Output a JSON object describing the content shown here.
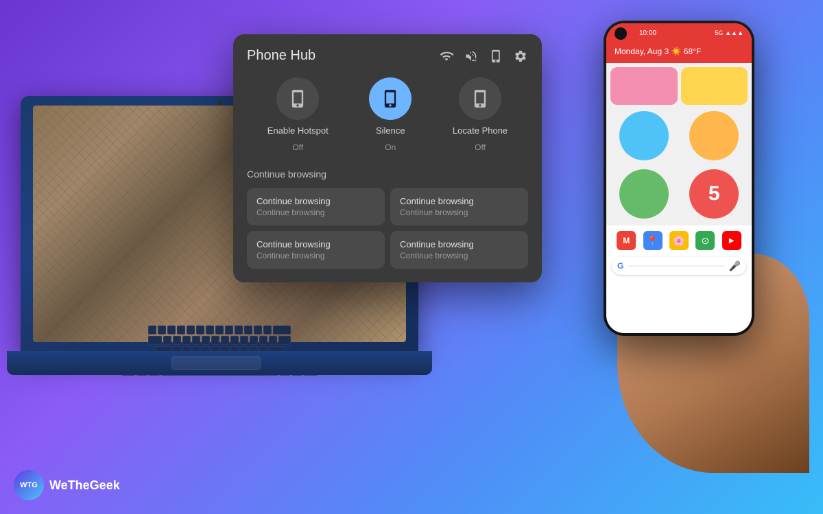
{
  "background": {
    "gradient_start": "#6a35d0",
    "gradient_end": "#38bdf8"
  },
  "phone_hub": {
    "title": "Phone Hub",
    "actions": [
      {
        "id": "hotspot",
        "label": "Enable Hotspot",
        "status": "Off",
        "active": false
      },
      {
        "id": "silence",
        "label": "Silence",
        "status": "On",
        "active": true
      },
      {
        "id": "locate",
        "label": "Locate Phone",
        "status": "Off",
        "active": false
      }
    ],
    "continue_section_label": "Continue browsing",
    "browsing_items": [
      {
        "title": "Continue browsing",
        "url": "Continue browsing"
      },
      {
        "title": "Continue browsing",
        "url": "Continue browsing"
      },
      {
        "title": "Continue browsing",
        "url": "Continue browsing"
      },
      {
        "title": "Continue browsing",
        "url": "Continue browsing"
      }
    ]
  },
  "phone": {
    "time": "10:00",
    "signal": "5G",
    "date_text": "Monday, Aug 3",
    "weather": "☀️ 68°F",
    "number_display": "5"
  },
  "brand": {
    "icon_text": "WTG",
    "name": "WeTheGeek"
  }
}
